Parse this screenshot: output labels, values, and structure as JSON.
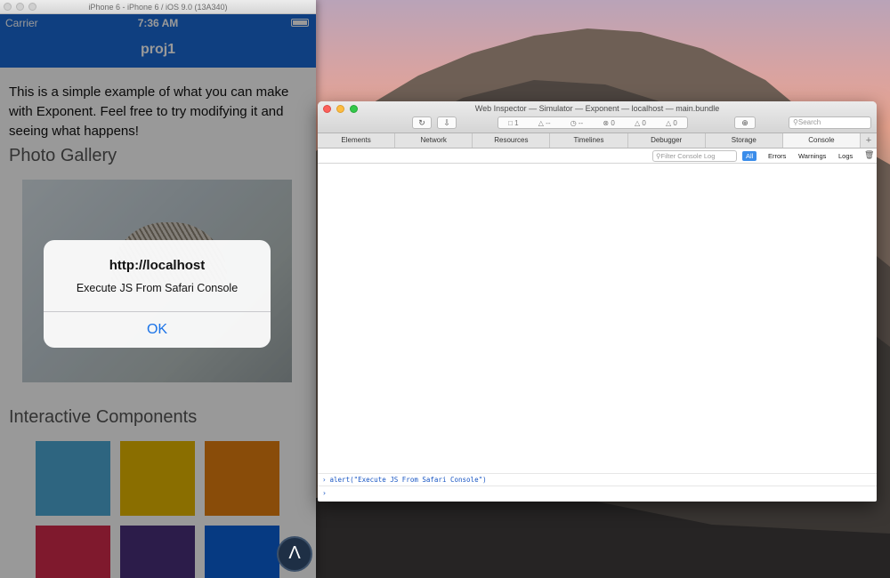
{
  "simulator": {
    "window_title": "iPhone 6 - iPhone 6 / iOS 9.0 (13A340)",
    "carrier": "Carrier",
    "time": "7:36 AM",
    "nav_title": "proj1",
    "intro_text": "This is a simple example of what you can make with Exponent. Feel free to try modifying it and seeing what happens!",
    "photo_heading": "Photo Gallery",
    "interactive_heading": "Interactive Components",
    "tile_colors": [
      "#4da9d6",
      "#e6b800",
      "#e47f10",
      "#d42a4c",
      "#4a2f7c",
      "#0a62d9"
    ],
    "alert": {
      "title": "http://localhost",
      "message": "Execute JS From Safari Console",
      "ok_label": "OK"
    },
    "fab_glyph": "Λ"
  },
  "inspector": {
    "window_title": "Web Inspector — Simulator — Exponent — localhost — main.bundle",
    "activity": [
      "1",
      "--",
      "--",
      "0",
      "0",
      "0"
    ],
    "search_placeholder": "Search",
    "tabs": [
      "Elements",
      "Network",
      "Resources",
      "Timelines",
      "Debugger",
      "Storage",
      "Console"
    ],
    "active_tab": "Console",
    "filter_placeholder": "Filter Console Log",
    "scopes": [
      "All",
      "Errors",
      "Warnings",
      "Logs"
    ],
    "console_command": "alert(\"Execute JS From Safari Console\")"
  },
  "colors": {
    "ios_blue": "#1a6ad6",
    "selected_scope": "#3b8dea"
  }
}
